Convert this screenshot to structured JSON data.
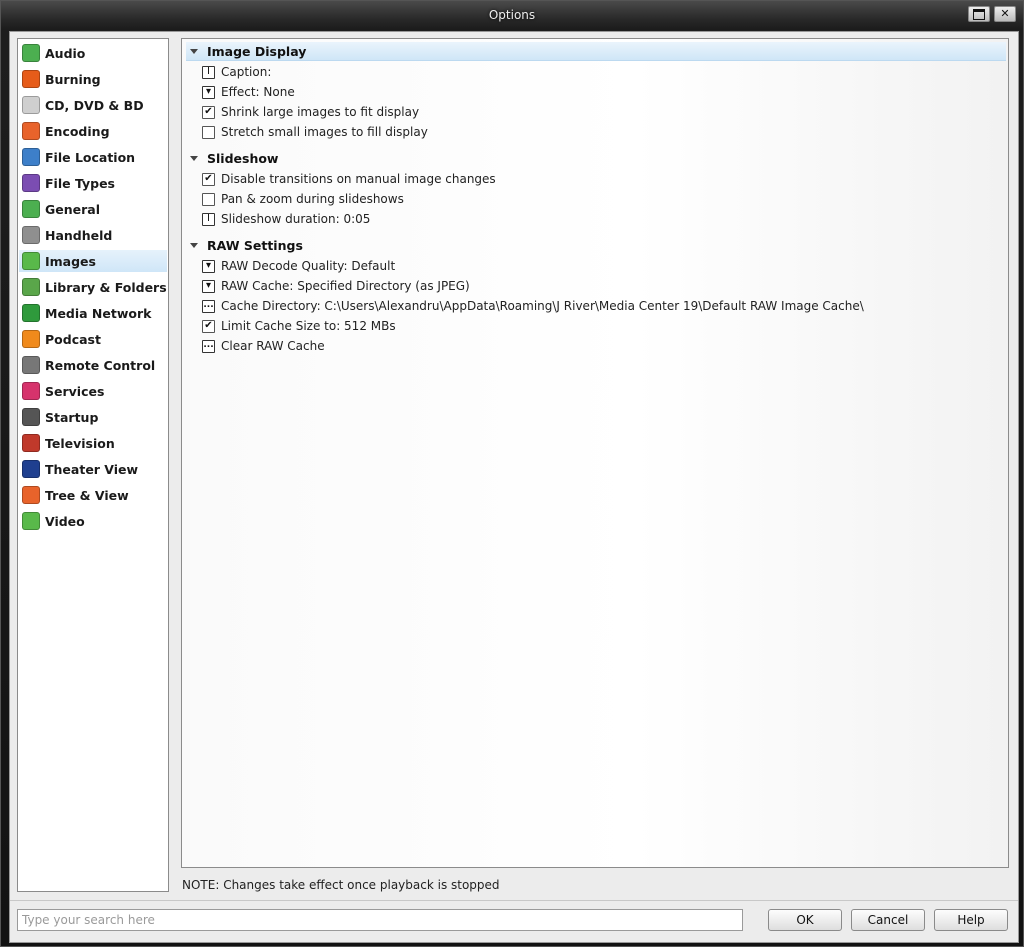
{
  "window": {
    "title": "Options"
  },
  "sidebar": {
    "items": [
      {
        "label": "Audio",
        "icon": "audio-icon",
        "color": "#4caf50"
      },
      {
        "label": "Burning",
        "icon": "burning-icon",
        "color": "#e65c1a"
      },
      {
        "label": "CD, DVD & BD",
        "icon": "disc-icon",
        "color": "#cfcfcf"
      },
      {
        "label": "Encoding",
        "icon": "encoding-icon",
        "color": "#e8632b"
      },
      {
        "label": "File Location",
        "icon": "globe-icon",
        "color": "#3d7fc9"
      },
      {
        "label": "File Types",
        "icon": "puzzle-icon",
        "color": "#7b4db2"
      },
      {
        "label": "General",
        "icon": "check-icon",
        "color": "#4caf50"
      },
      {
        "label": "Handheld",
        "icon": "handheld-icon",
        "color": "#8f8f8f"
      },
      {
        "label": "Images",
        "icon": "images-icon",
        "color": "#59b94a"
      },
      {
        "label": "Library & Folders",
        "icon": "library-icon",
        "color": "#5aa64a"
      },
      {
        "label": "Media Network",
        "icon": "network-icon",
        "color": "#2f9a3c"
      },
      {
        "label": "Podcast",
        "icon": "rss-icon",
        "color": "#f08a1c"
      },
      {
        "label": "Remote Control",
        "icon": "remote-icon",
        "color": "#777777"
      },
      {
        "label": "Services",
        "icon": "services-icon",
        "color": "#d6336c"
      },
      {
        "label": "Startup",
        "icon": "startup-icon",
        "color": "#555555"
      },
      {
        "label": "Television",
        "icon": "tv-icon",
        "color": "#c0392b"
      },
      {
        "label": "Theater View",
        "icon": "theater-icon",
        "color": "#1f3f8f"
      },
      {
        "label": "Tree & View",
        "icon": "tree-icon",
        "color": "#e8632b"
      },
      {
        "label": "Video",
        "icon": "video-icon",
        "color": "#59b94a"
      }
    ],
    "selected": "Images"
  },
  "sections": [
    {
      "title": "Image Display",
      "options": [
        {
          "type": "text",
          "label": "Caption:"
        },
        {
          "type": "dropdown",
          "label": "Effect: None"
        },
        {
          "type": "checkbox",
          "checked": true,
          "label": "Shrink large images to fit display"
        },
        {
          "type": "checkbox",
          "checked": false,
          "label": "Stretch small images to fill display"
        }
      ]
    },
    {
      "title": "Slideshow",
      "options": [
        {
          "type": "checkbox",
          "checked": true,
          "label": "Disable transitions on manual image changes"
        },
        {
          "type": "checkbox",
          "checked": false,
          "label": "Pan & zoom during slideshows"
        },
        {
          "type": "text",
          "label": "Slideshow duration: 0:05"
        }
      ]
    },
    {
      "title": "RAW Settings",
      "options": [
        {
          "type": "dropdown",
          "label": "RAW Decode Quality: Default"
        },
        {
          "type": "dropdown",
          "label": "RAW Cache: Specified Directory (as JPEG)"
        },
        {
          "type": "browse",
          "label": "Cache Directory: C:\\Users\\Alexandru\\AppData\\Roaming\\J River\\Media Center 19\\Default RAW Image Cache\\"
        },
        {
          "type": "checkbox",
          "checked": true,
          "label": "Limit Cache Size to: 512 MBs"
        },
        {
          "type": "browse",
          "label": "Clear RAW Cache"
        }
      ]
    }
  ],
  "footer": {
    "note": "NOTE: Changes take effect once playback is stopped",
    "search_placeholder": "Type your search here",
    "ok_label": "OK",
    "cancel_label": "Cancel",
    "help_label": "Help"
  }
}
